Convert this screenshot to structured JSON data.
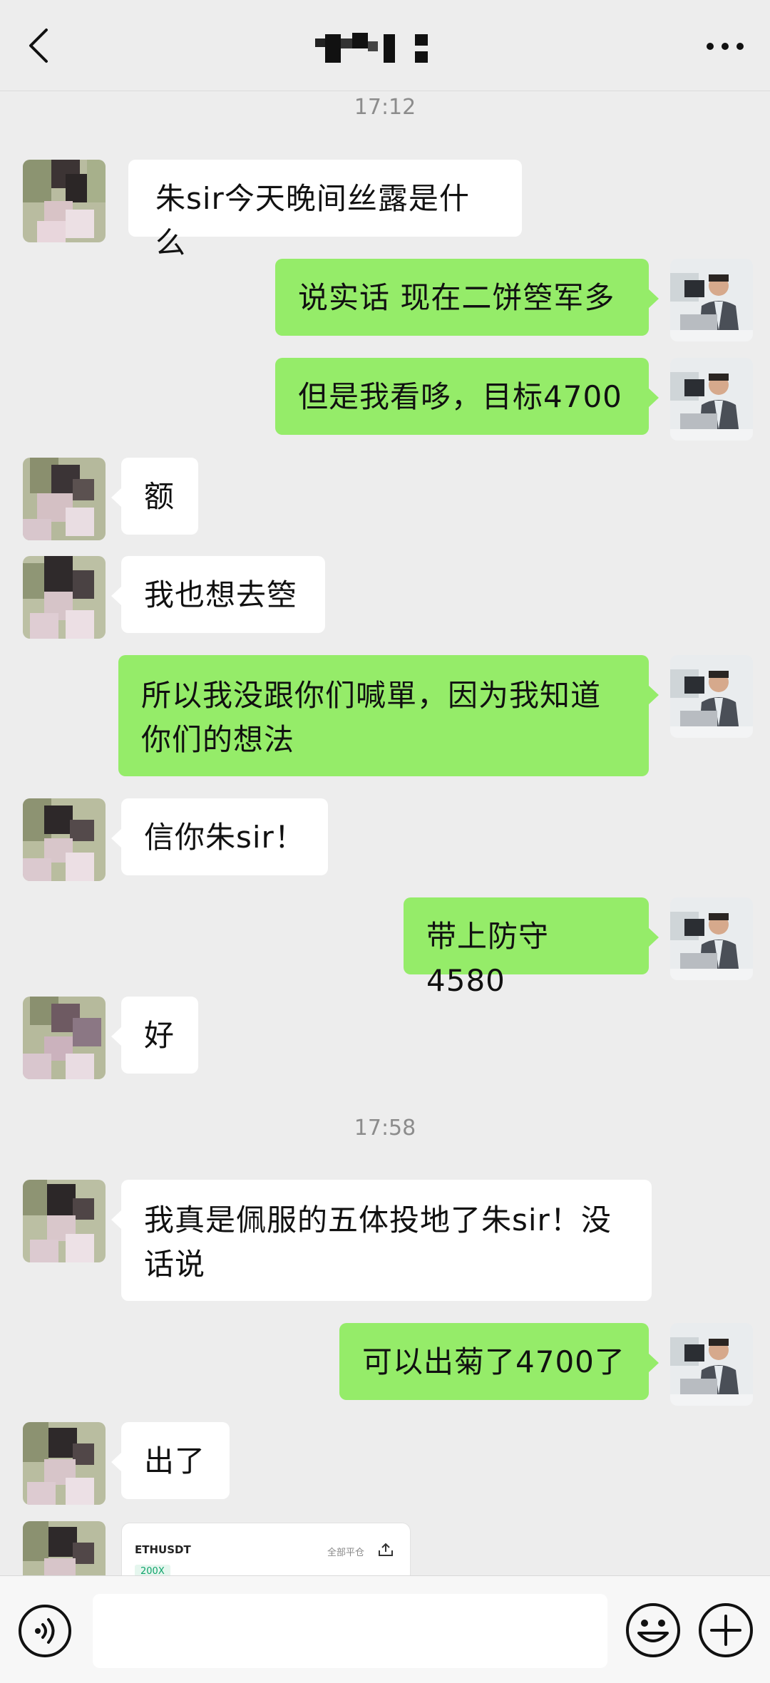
{
  "header": {
    "title": "",
    "back_icon": "chevron-left-icon",
    "more_icon": "more-dots-icon"
  },
  "colors": {
    "background": "#ededed",
    "outgoing_bubble": "#95ec69",
    "incoming_bubble": "#ffffff",
    "timestamp_text": "#8c8c8c"
  },
  "timestamps": [
    "17:12",
    "17:58"
  ],
  "messages": [
    {
      "side": "in",
      "text": "朱sir今天晚间丝露是什么"
    },
    {
      "side": "out",
      "text": "说实话 现在二饼箜军多"
    },
    {
      "side": "out",
      "text": "但是我看哆，目标4700"
    },
    {
      "side": "in",
      "text": "额"
    },
    {
      "side": "in",
      "text": "我也想去箜"
    },
    {
      "side": "out",
      "text": "所以我没跟你们喊單，因为我知道你们的想法"
    },
    {
      "side": "in",
      "text": "信你朱sir！"
    },
    {
      "side": "out",
      "text": "带上防守4580"
    },
    {
      "side": "in",
      "text": "好"
    },
    {
      "side": "in",
      "text": "我真是佩服的五体投地了朱sir！没话说"
    },
    {
      "side": "out",
      "text": "可以出菊了4700了"
    },
    {
      "side": "in",
      "text": "出了"
    }
  ],
  "trade_card": {
    "symbol": "ETHUSDT",
    "action": "全部平仓",
    "leverage": "200X",
    "share_icon": "share-icon"
  },
  "input_bar": {
    "value": "",
    "voice_icon": "voice-icon",
    "emoji_icon": "emoji-icon",
    "plus_icon": "plus-icon"
  }
}
